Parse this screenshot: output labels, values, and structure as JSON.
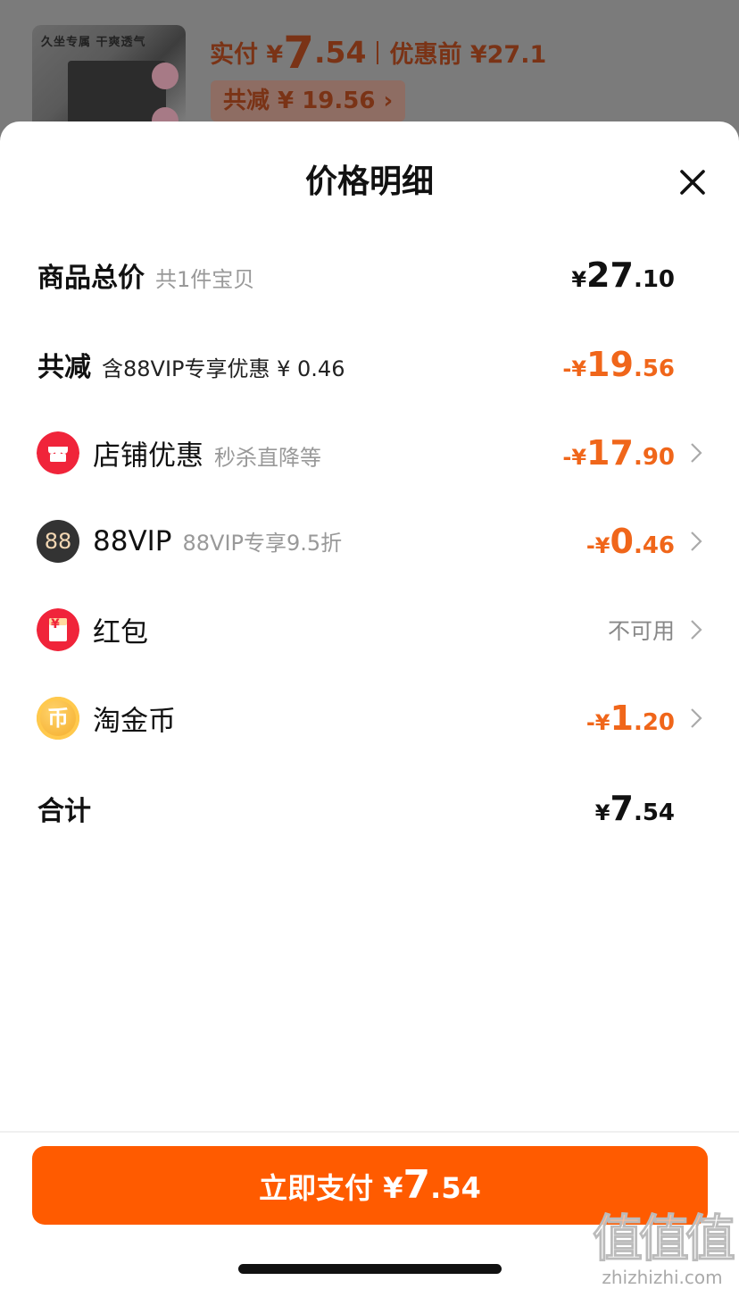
{
  "background": {
    "thumb_caption": "久坐专属  干爽透气",
    "pay_prefix": "实付 ¥",
    "pay_int": "7",
    "pay_dec": ".54",
    "before_label": "优惠前 ¥27.1",
    "reduce_tag": "共减 ¥ 19.56 ›"
  },
  "sheet": {
    "title": "价格明细",
    "close_icon": "close-icon",
    "rows": {
      "total": {
        "label": "商品总价",
        "sub": "共1件宝贝",
        "cur": "¥",
        "int": "27",
        "dec": ".10"
      },
      "reduced": {
        "label": "共减",
        "sub": "含88VIP专享优惠 ¥ 0.46",
        "cur": "-¥",
        "int": "19",
        "dec": ".56"
      },
      "shop": {
        "label": "店铺优惠",
        "sub": "秒杀直降等",
        "cur": "-¥",
        "int": "17",
        "dec": ".90",
        "icon": "store-icon"
      },
      "vip": {
        "label": "88VIP",
        "sub": "88VIP专享9.5折",
        "cur": "-¥",
        "int": "0",
        "dec": ".46",
        "icon": "vip-88-icon",
        "icon_text": "88"
      },
      "redpacket": {
        "label": "红包",
        "status": "不可用",
        "icon": "red-packet-icon",
        "icon_text": "¥"
      },
      "coins": {
        "label": "淘金币",
        "cur": "-¥",
        "int": "1",
        "dec": ".20",
        "icon": "coin-icon",
        "icon_text": "币"
      },
      "sum": {
        "label": "合计",
        "cur": "¥",
        "int": "7",
        "dec": ".54"
      }
    }
  },
  "pay_button": {
    "label": "立即支付 ¥",
    "int": "7",
    "dec": ".54"
  },
  "watermark": {
    "cn": "值值值",
    "en": "zhizhizhi.com"
  },
  "colors": {
    "accent": "#ff5b00",
    "discount": "#f0661a",
    "store_icon": "#f0243a",
    "vip_icon": "#333333",
    "coin_icon": "#f6b73c"
  }
}
